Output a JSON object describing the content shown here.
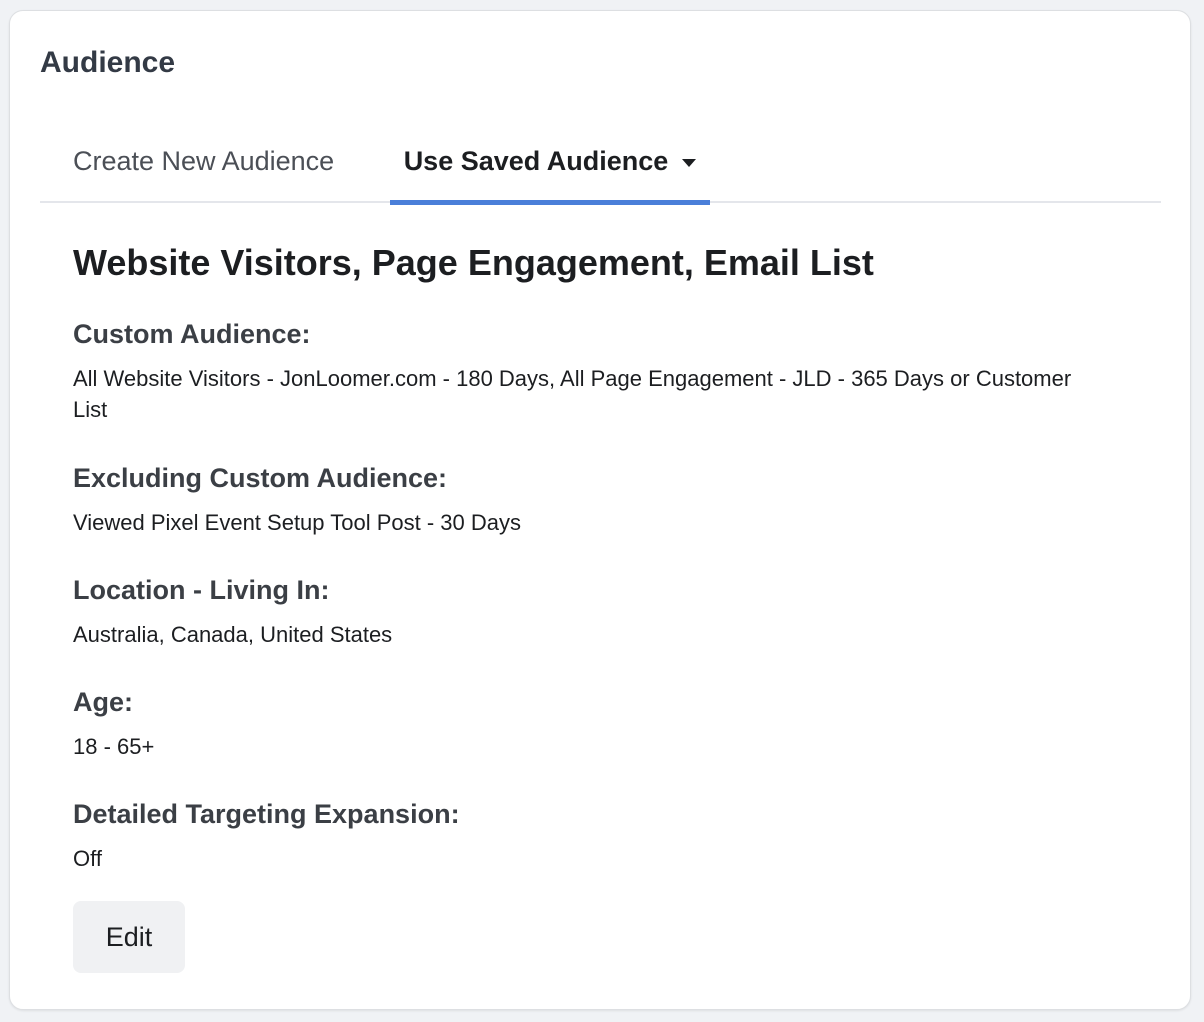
{
  "card": {
    "title": "Audience"
  },
  "tabs": [
    {
      "label": "Create New Audience",
      "active": false
    },
    {
      "label": "Use Saved Audience",
      "active": true,
      "icon": "chevron-down-icon"
    }
  ],
  "audience": {
    "name": "Website Visitors, Page Engagement, Email List",
    "fields": [
      {
        "label": "Custom Audience:",
        "value": "All Website Visitors - JonLoomer.com - 180 Days, All Page Engagement - JLD - 365 Days or Customer List"
      },
      {
        "label": "Excluding Custom Audience:",
        "value": "Viewed Pixel Event Setup Tool Post - 30 Days"
      },
      {
        "label": "Location - Living In:",
        "value": "Australia, Canada, United States"
      },
      {
        "label": "Age:",
        "value": "18 - 65+"
      },
      {
        "label": "Detailed Targeting Expansion:",
        "value": "Off"
      }
    ]
  },
  "actions": {
    "edit_label": "Edit"
  },
  "colors": {
    "active_tab_underline": "#4a7fd9",
    "card_background": "#ffffff",
    "page_background": "#f0f2f5"
  }
}
